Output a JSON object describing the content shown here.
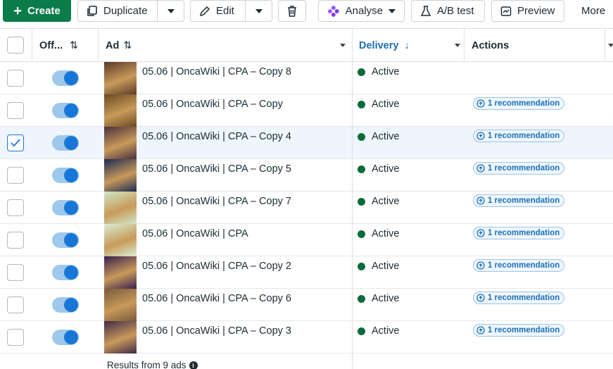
{
  "toolbar": {
    "create_label": "Create",
    "duplicate_label": "Duplicate",
    "edit_label": "Edit",
    "analyse_label": "Analyse",
    "ab_test_label": "A/B test",
    "preview_label": "Preview",
    "more_label": "More"
  },
  "columns": {
    "off": "Off...",
    "ad": "Ad",
    "delivery": "Delivery",
    "actions": "Actions"
  },
  "rows": [
    {
      "name": "05.06 | OncaWiki | CPA – Copy 8",
      "status": "Active",
      "recommendation": "",
      "checked": false,
      "thumb_color": "#5a3a2a"
    },
    {
      "name": "05.06 | OncaWiki | CPA – Copy",
      "status": "Active",
      "recommendation": "1 recommendation",
      "checked": false,
      "thumb_color": "#6a4a20"
    },
    {
      "name": "05.06 | OncaWiki | CPA – Copy 4",
      "status": "Active",
      "recommendation": "1 recommendation",
      "checked": true,
      "thumb_color": "#4a3040"
    },
    {
      "name": "05.06 | OncaWiki | CPA – Copy 5",
      "status": "Active",
      "recommendation": "1 recommendation",
      "checked": false,
      "thumb_color": "#1d2a55"
    },
    {
      "name": "05.06 | OncaWiki | CPA – Copy 7",
      "status": "Active",
      "recommendation": "1 recommendation",
      "checked": false,
      "thumb_color": "#cfe8c8"
    },
    {
      "name": "05.06 | OncaWiki | CPA",
      "status": "Active",
      "recommendation": "1 recommendation",
      "checked": false,
      "thumb_color": "#d8efd4"
    },
    {
      "name": "05.06 | OncaWiki | CPA – Copy 2",
      "status": "Active",
      "recommendation": "1 recommendation",
      "checked": false,
      "thumb_color": "#3a2050"
    },
    {
      "name": "05.06 | OncaWiki | CPA – Copy 6",
      "status": "Active",
      "recommendation": "1 recommendation",
      "checked": false,
      "thumb_color": "#7a5a3a"
    },
    {
      "name": "05.06 | OncaWiki | CPA – Copy 3",
      "status": "Active",
      "recommendation": "1 recommendation",
      "checked": false,
      "thumb_color": "#402a48"
    }
  ],
  "footer": {
    "results_label": "Results from 9 ads"
  },
  "colors": {
    "create_green": "#0a7c4a",
    "delivery_blue": "#1d6fb8",
    "active_green": "#0b6b3a",
    "toggle_on": "#1877d6"
  }
}
